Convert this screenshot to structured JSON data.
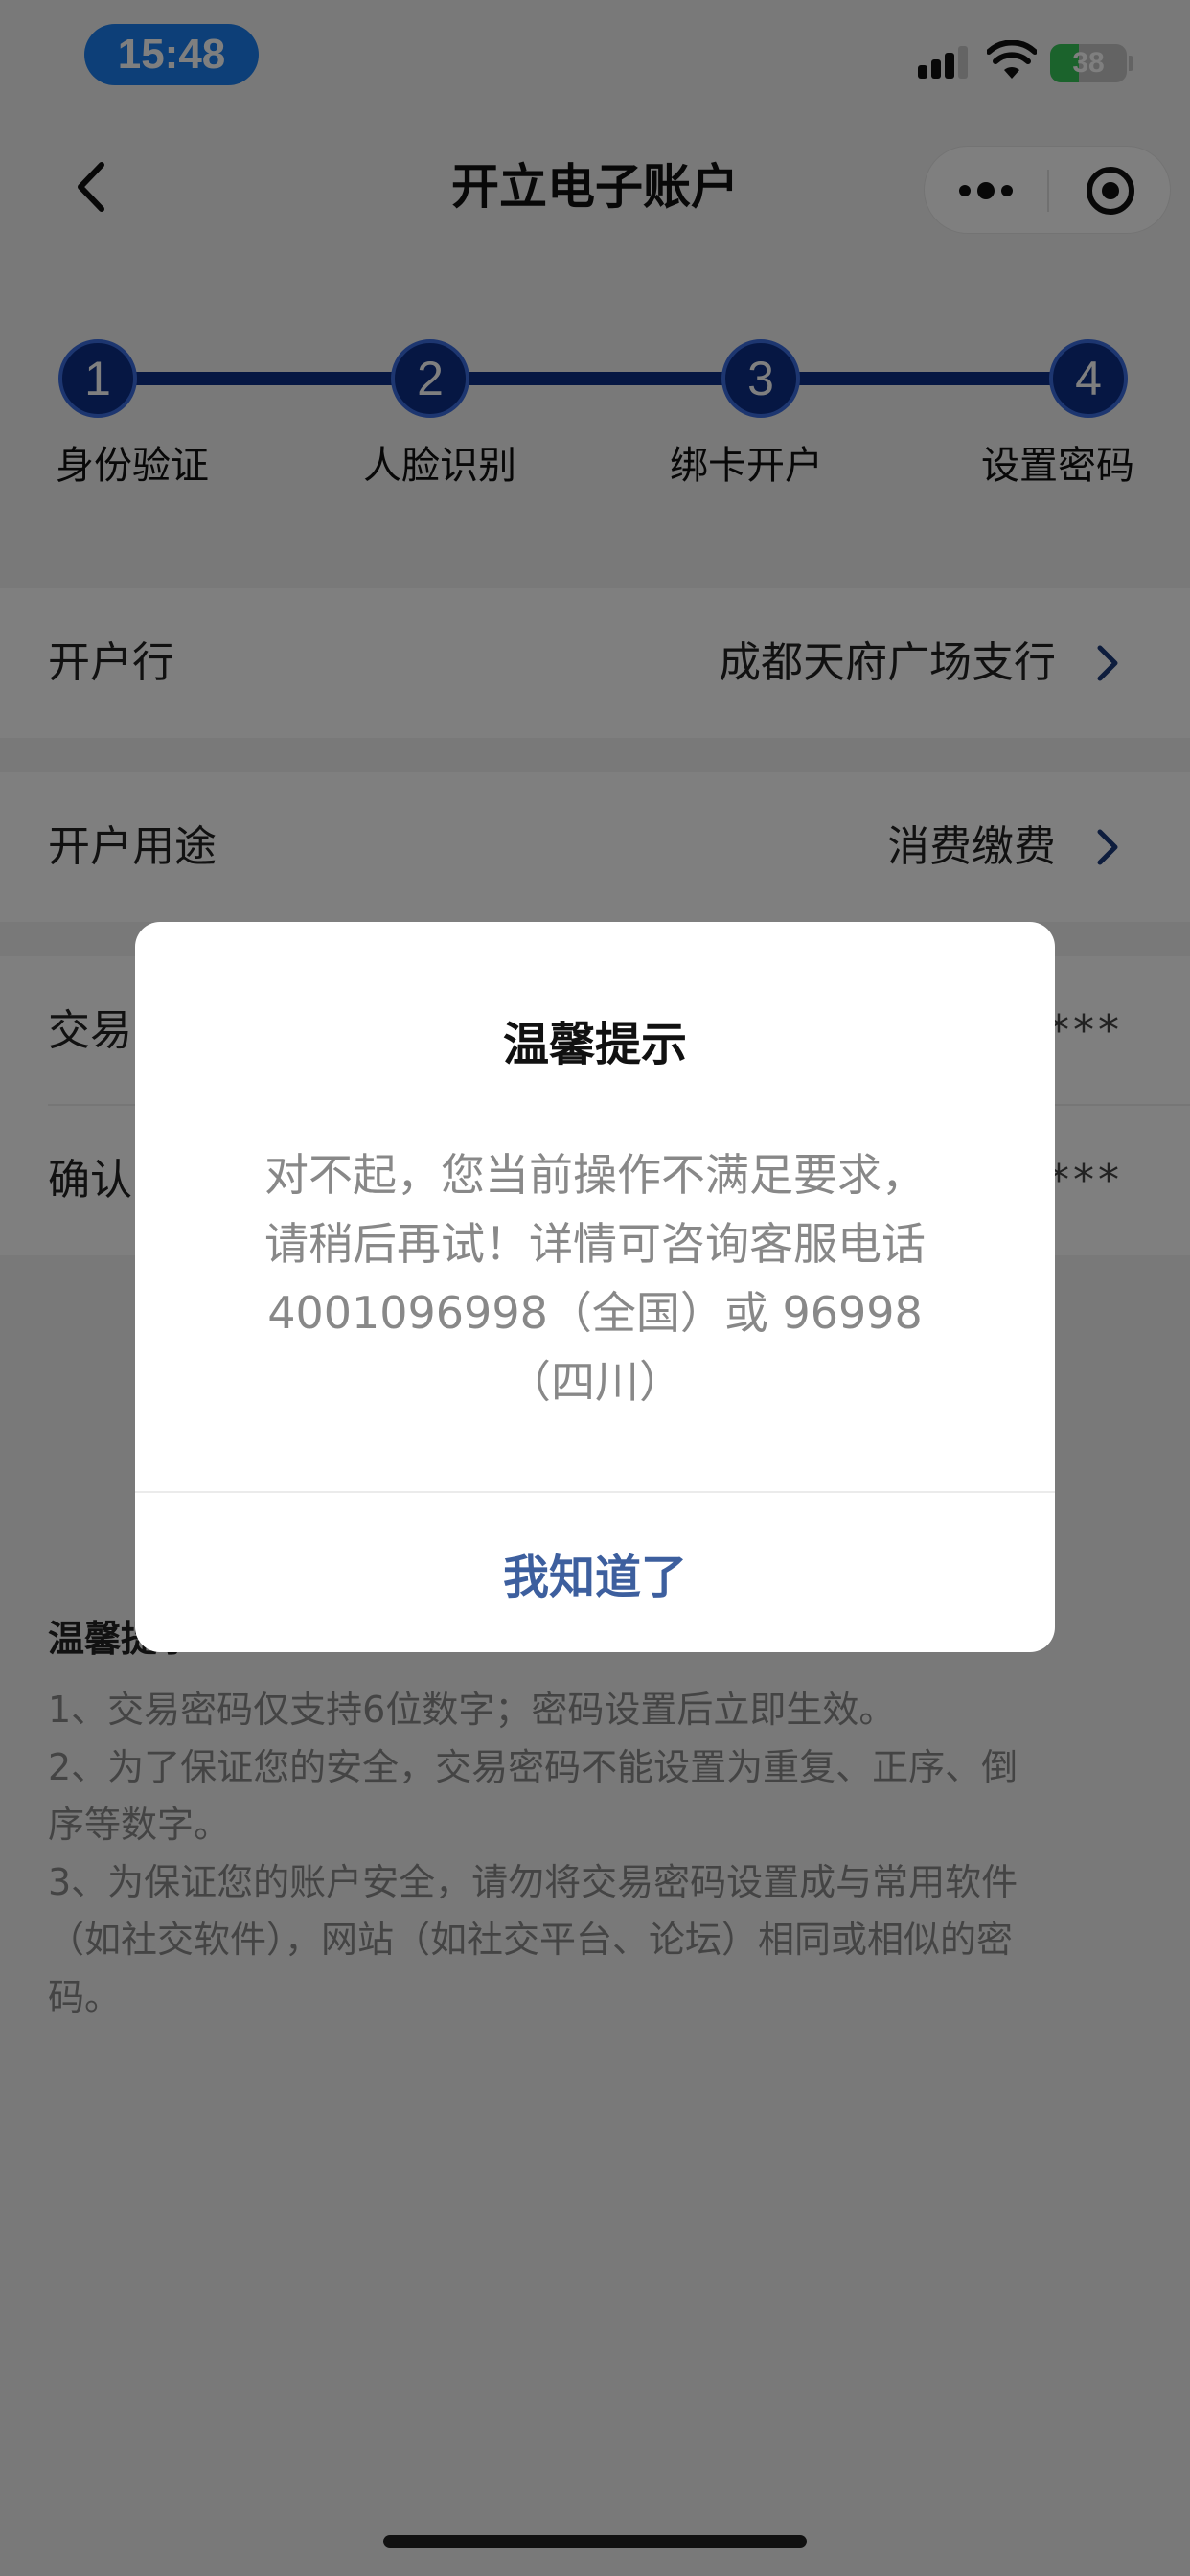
{
  "status_bar": {
    "time": "15:48",
    "battery_level": "38",
    "battery_fraction": 0.38,
    "icons": [
      "signal-icon",
      "wifi-icon",
      "battery-icon"
    ]
  },
  "nav": {
    "title": "开立电子账户",
    "back_icon": "chevron-left-icon",
    "more_icon": "more-dots-icon",
    "close_icon": "target-circle-icon"
  },
  "steps": [
    {
      "number": "1",
      "label": "身份验证"
    },
    {
      "number": "2",
      "label": "人脸识别"
    },
    {
      "number": "3",
      "label": "绑卡开户"
    },
    {
      "number": "4",
      "label": "设置密码"
    }
  ],
  "form": {
    "bank": {
      "label": "开户行",
      "value": "成都天府广场支行"
    },
    "purpose": {
      "label": "开户用途",
      "value": "消费缴费"
    },
    "trade_password": {
      "label": "交易",
      "mask": "***"
    },
    "confirm_password": {
      "label": "确认",
      "mask": "***"
    }
  },
  "tips": {
    "title": "温馨提示",
    "lines": [
      "1、交易密码仅支持6位数字；密码设置后立即生效。",
      "2、为了保证您的安全，交易密码不能设置为重复、正序、倒",
      "序等数字。",
      "3、为保证您的账户安全，请勿将交易密码设置成与常用软件",
      "（如社交软件），网站（如社交平台、论坛）相同或相似的密",
      "码。"
    ]
  },
  "dialog": {
    "title": "温馨提示",
    "message_lines": [
      "对不起，您当前操作不满足要求，",
      "请稍后再试！详情可咨询客服电话",
      "4001096998（全国）或 96998",
      "（四川）"
    ],
    "button": "我知道了"
  },
  "colors": {
    "accent_blue": "#0c2f86",
    "time_pill": "#1a7ff0",
    "dialog_button": "#3d5f9e"
  }
}
